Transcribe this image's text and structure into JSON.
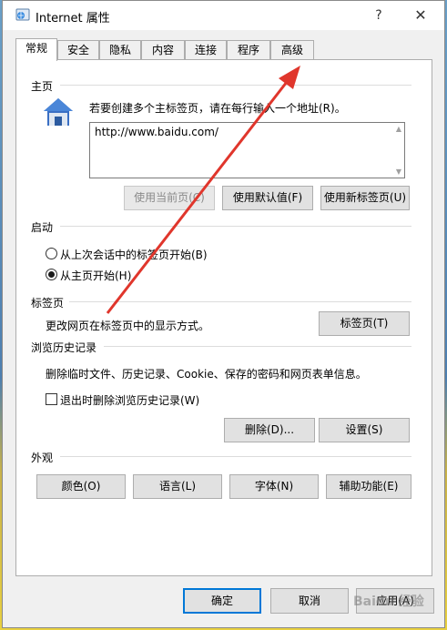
{
  "window": {
    "title": "Internet 属性",
    "help": "?",
    "close": "✕"
  },
  "tabs": [
    {
      "label": "常规",
      "active": true
    },
    {
      "label": "安全"
    },
    {
      "label": "隐私"
    },
    {
      "label": "内容"
    },
    {
      "label": "连接"
    },
    {
      "label": "程序"
    },
    {
      "label": "高级"
    }
  ],
  "home": {
    "group_label": "主页",
    "instruction": "若要创建多个主标签页，请在每行输入一个地址(R)。",
    "url_value": "http://www.baidu.com/",
    "btn_current": "使用当前页(C)",
    "btn_default": "使用默认值(F)",
    "btn_newtab": "使用新标签页(U)"
  },
  "startup": {
    "group_label": "启动",
    "option_last_session": "从上次会话中的标签页开始(B)",
    "option_home": "从主页开始(H)",
    "selected": "home"
  },
  "tabs_group": {
    "group_label": "标签页",
    "description": "更改网页在标签页中的显示方式。",
    "button": "标签页(T)"
  },
  "history": {
    "group_label": "浏览历史记录",
    "description": "删除临时文件、历史记录、Cookie、保存的密码和网页表单信息。",
    "checkbox_label": "退出时删除浏览历史记录(W)",
    "checkbox_checked": false,
    "delete_button": "删除(D)...",
    "settings_button": "设置(S)"
  },
  "appearance": {
    "group_label": "外观",
    "colors_button": "颜色(O)",
    "languages_button": "语言(L)",
    "fonts_button": "字体(N)",
    "accessibility_button": "辅助功能(E)"
  },
  "footer": {
    "ok": "确定",
    "cancel": "取消",
    "apply": "应用(A)"
  },
  "watermark": "Baidu 经验",
  "annotation_arrow_color": "#e0362c"
}
